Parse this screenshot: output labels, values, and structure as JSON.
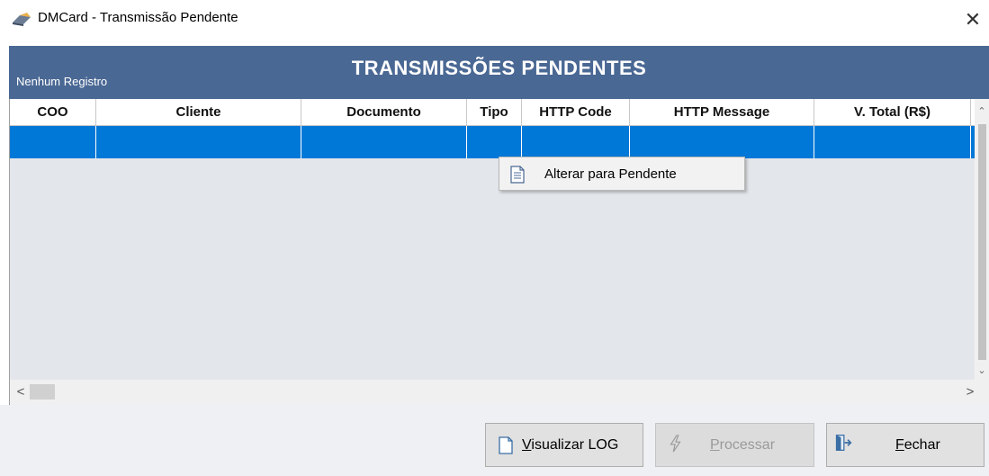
{
  "window": {
    "title": "DMCard - Transmissão Pendente",
    "close_glyph": "✕",
    "app_icon": "printer-icon"
  },
  "header": {
    "record_count": "Nenhum Registro",
    "title": "TRANSMISSÕES PENDENTES",
    "background": "#4a6894"
  },
  "grid": {
    "columns": [
      "COO",
      "Cliente",
      "Documento",
      "Tipo",
      "HTTP Code",
      "HTTP Message",
      "V. Total (R$)"
    ],
    "selected_row_color": "#0078d7",
    "rows": [
      [
        "",
        "",
        "",
        "",
        "",
        "",
        ""
      ]
    ],
    "scroll": {
      "up": "⌃",
      "down": "⌄",
      "left": "<",
      "right": ">"
    }
  },
  "context_menu": {
    "items": [
      {
        "label": "Alterar para Pendente",
        "icon": "document-icon"
      }
    ]
  },
  "footer": {
    "buttons": {
      "log": {
        "label": "Visualizar LOG",
        "accesskey": "V",
        "icon": "document-icon"
      },
      "process": {
        "label": "Processar",
        "accesskey": "P",
        "icon": "lightning-icon",
        "disabled": true
      },
      "close": {
        "label": "Fechar",
        "accesskey": "F",
        "icon": "exit-door-icon"
      }
    }
  }
}
